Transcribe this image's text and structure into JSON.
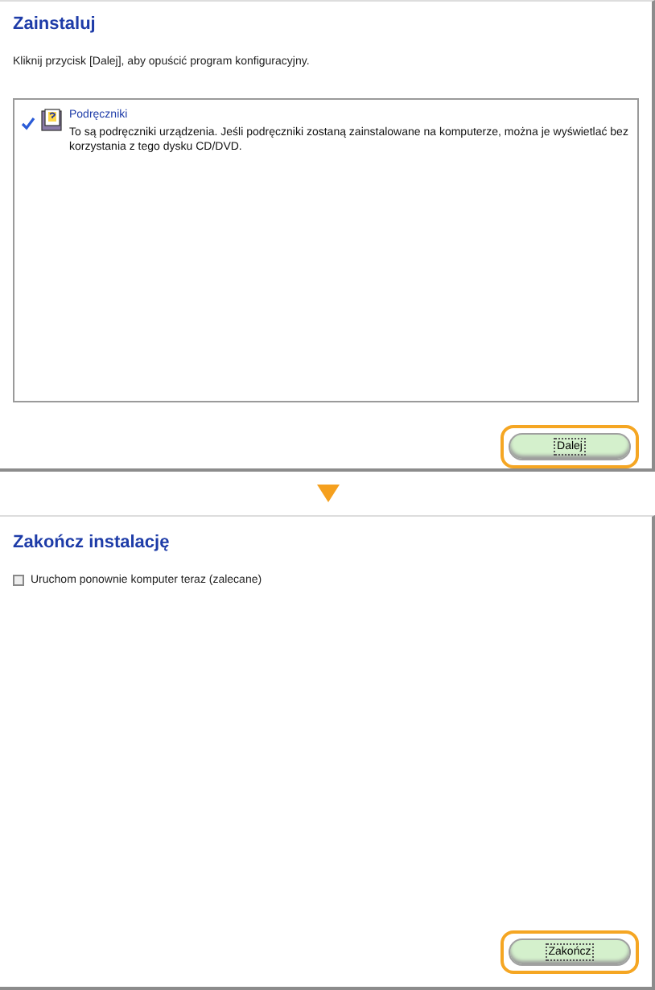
{
  "install_step": {
    "title": "Zainstaluj",
    "instruction": "Kliknij przycisk [Dalej], aby opuścić program konfiguracyjny.",
    "components": [
      {
        "name": "Podręczniki",
        "description": "To są podręczniki urządzenia. Jeśli podręczniki zostaną zainstalowane na komputerze, można je wyświetlać bez korzystania z tego dysku CD/DVD.",
        "checked": true
      }
    ],
    "button": "Dalej"
  },
  "finish_step": {
    "title": "Zakończ instalację",
    "restart_option": {
      "label": "Uruchom ponownie komputer teraz (zalecane)",
      "checked": false
    },
    "button": "Zakończ"
  }
}
